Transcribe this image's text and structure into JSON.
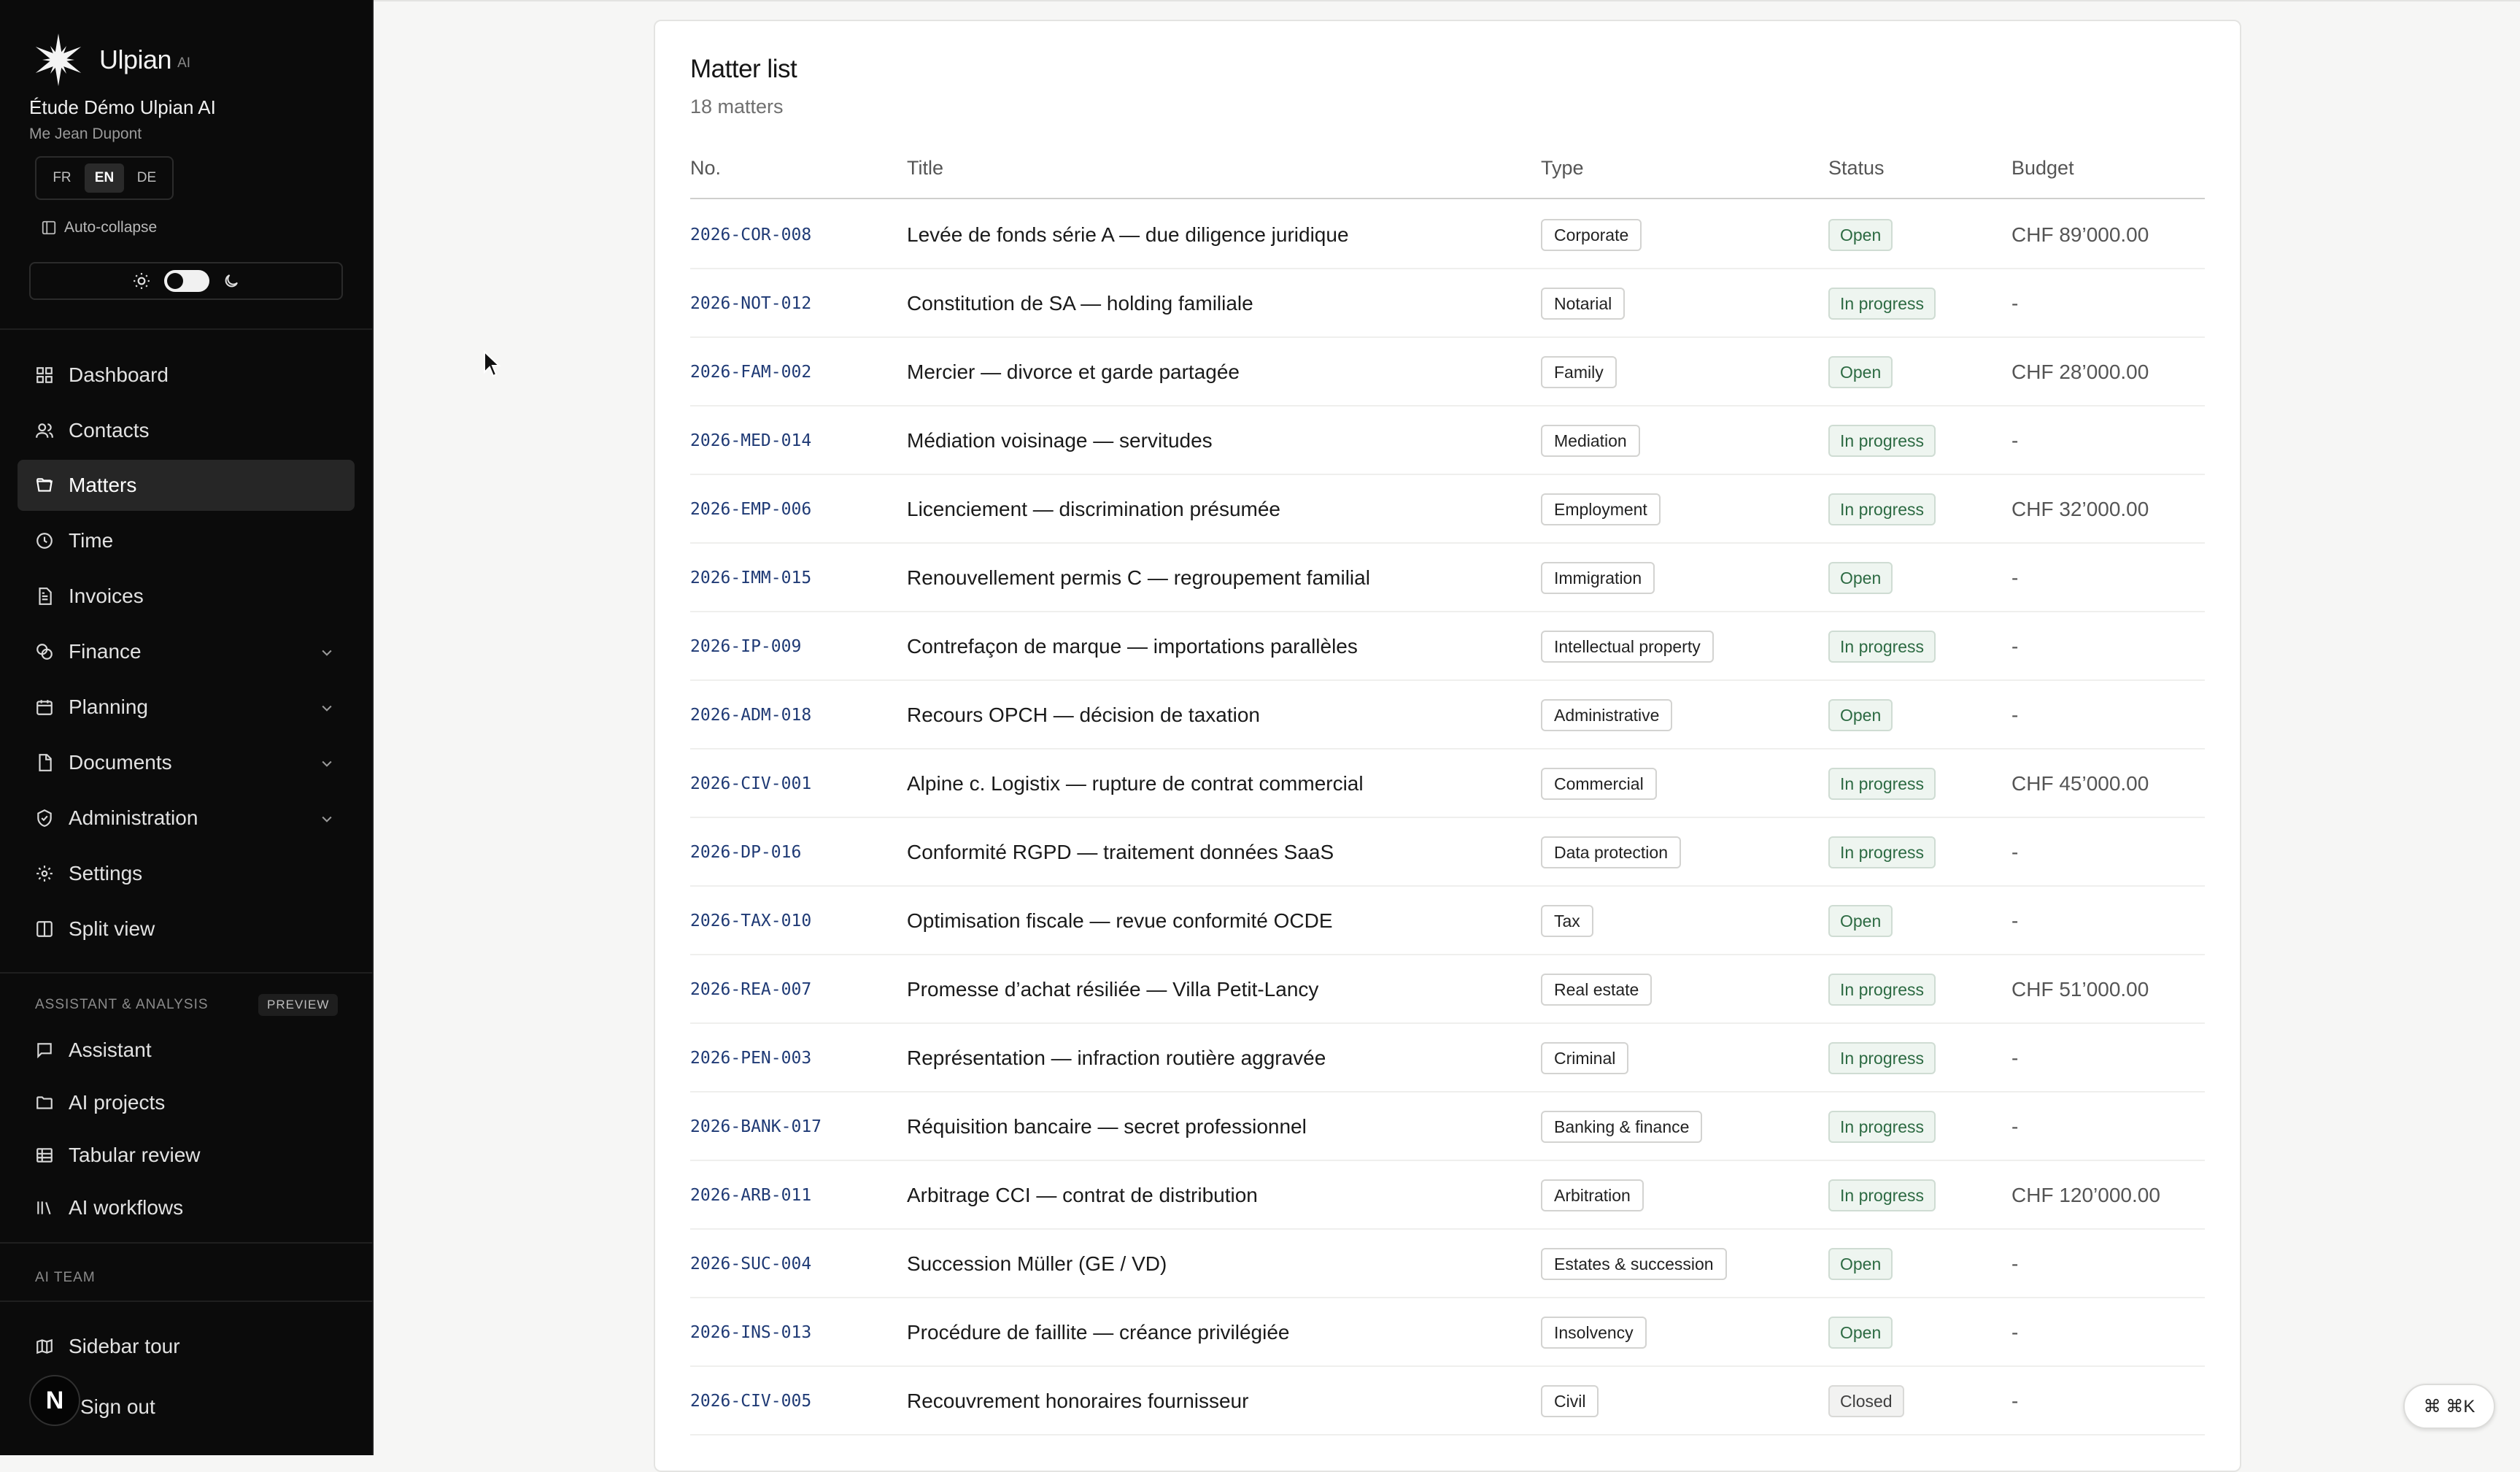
{
  "brand": {
    "name": "Ulpian",
    "suffix": "AI"
  },
  "firm": {
    "name": "Étude Démo Ulpian AI",
    "user": "Me Jean Dupont"
  },
  "languages": [
    {
      "code": "FR",
      "active": false
    },
    {
      "code": "EN",
      "active": true
    },
    {
      "code": "DE",
      "active": false
    }
  ],
  "sidebar": {
    "auto_collapse_label": "Auto-collapse",
    "theme": {
      "mode": "light"
    },
    "nav": [
      {
        "label": "Dashboard",
        "icon": "grid-icon"
      },
      {
        "label": "Contacts",
        "icon": "users-icon"
      },
      {
        "label": "Matters",
        "icon": "folder-open-icon",
        "active": true
      },
      {
        "label": "Time",
        "icon": "clock-icon"
      },
      {
        "label": "Invoices",
        "icon": "file-text-icon"
      },
      {
        "label": "Finance",
        "icon": "coins-icon",
        "expandable": true
      },
      {
        "label": "Planning",
        "icon": "calendar-icon",
        "expandable": true
      },
      {
        "label": "Documents",
        "icon": "file-icon",
        "expandable": true
      },
      {
        "label": "Administration",
        "icon": "shield-check-icon",
        "expandable": true
      },
      {
        "label": "Settings",
        "icon": "gear-icon"
      },
      {
        "label": "Split view",
        "icon": "columns-icon"
      }
    ],
    "assistant_section": {
      "label": "ASSISTANT & ANALYSIS",
      "badge": "PREVIEW",
      "items": [
        {
          "label": "Assistant",
          "icon": "message-icon"
        },
        {
          "label": "AI projects",
          "icon": "folder-icon"
        },
        {
          "label": "Tabular review",
          "icon": "table-icon"
        },
        {
          "label": "AI workflows",
          "icon": "library-icon"
        }
      ]
    },
    "ai_team_label": "AI TEAM",
    "sidebar_tour_label": "Sidebar tour",
    "avatar_initial": "N",
    "sign_out_label": "Sign out"
  },
  "main": {
    "title": "Matter list",
    "subtitle": "18 matters",
    "columns": [
      "No.",
      "Title",
      "Type",
      "Status",
      "Budget"
    ],
    "rows": [
      {
        "no": "2026-COR-008",
        "title": "Levée de fonds série A — due diligence juridique",
        "type": "Corporate",
        "status": "Open",
        "budget": "CHF 89’000.00"
      },
      {
        "no": "2026-NOT-012",
        "title": "Constitution de SA — holding familiale",
        "type": "Notarial",
        "status": "In progress",
        "budget": "-"
      },
      {
        "no": "2026-FAM-002",
        "title": "Mercier — divorce et garde partagée",
        "type": "Family",
        "status": "Open",
        "budget": "CHF 28’000.00"
      },
      {
        "no": "2026-MED-014",
        "title": "Médiation voisinage — servitudes",
        "type": "Mediation",
        "status": "In progress",
        "budget": "-"
      },
      {
        "no": "2026-EMP-006",
        "title": "Licenciement — discrimination présumée",
        "type": "Employment",
        "status": "In progress",
        "budget": "CHF 32’000.00"
      },
      {
        "no": "2026-IMM-015",
        "title": "Renouvellement permis C — regroupement familial",
        "type": "Immigration",
        "status": "Open",
        "budget": "-"
      },
      {
        "no": "2026-IP-009",
        "title": "Contrefaçon de marque — importations parallèles",
        "type": "Intellectual property",
        "status": "In progress",
        "budget": "-"
      },
      {
        "no": "2026-ADM-018",
        "title": "Recours OPCH — décision de taxation",
        "type": "Administrative",
        "status": "Open",
        "budget": "-"
      },
      {
        "no": "2026-CIV-001",
        "title": "Alpine c. Logistix — rupture de contrat commercial",
        "type": "Commercial",
        "status": "In progress",
        "budget": "CHF 45’000.00"
      },
      {
        "no": "2026-DP-016",
        "title": "Conformité RGPD — traitement données SaaS",
        "type": "Data protection",
        "status": "In progress",
        "budget": "-"
      },
      {
        "no": "2026-TAX-010",
        "title": "Optimisation fiscale — revue conformité OCDE",
        "type": "Tax",
        "status": "Open",
        "budget": "-"
      },
      {
        "no": "2026-REA-007",
        "title": "Promesse d’achat résiliée — Villa Petit-Lancy",
        "type": "Real estate",
        "status": "In progress",
        "budget": "CHF 51’000.00"
      },
      {
        "no": "2026-PEN-003",
        "title": "Représentation — infraction routière aggravée",
        "type": "Criminal",
        "status": "In progress",
        "budget": "-"
      },
      {
        "no": "2026-BANK-017",
        "title": "Réquisition bancaire — secret professionnel",
        "type": "Banking & finance",
        "status": "In progress",
        "budget": "-"
      },
      {
        "no": "2026-ARB-011",
        "title": "Arbitrage CCI — contrat de distribution",
        "type": "Arbitration",
        "status": "In progress",
        "budget": "CHF 120’000.00"
      },
      {
        "no": "2026-SUC-004",
        "title": "Succession Müller (GE / VD)",
        "type": "Estates & succession",
        "status": "Open",
        "budget": "-"
      },
      {
        "no": "2026-INS-013",
        "title": "Procédure de faillite — créance privilégiée",
        "type": "Insolvency",
        "status": "Open",
        "budget": "-"
      },
      {
        "no": "2026-CIV-005",
        "title": "Recouvrement honoraires fournisseur",
        "type": "Civil",
        "status": "Closed",
        "budget": "-"
      }
    ]
  },
  "command_palette": {
    "label": "⌘ ⌘K"
  },
  "colors": {
    "sidebar_bg": "#0b0b0b",
    "status_green": "#2c6a42",
    "matter_no": "#1f3a75"
  }
}
